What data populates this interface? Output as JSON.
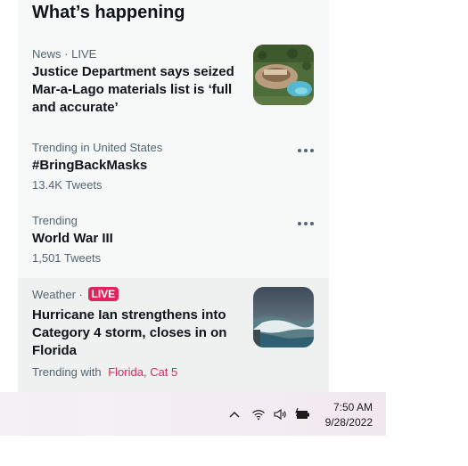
{
  "panel": {
    "title": "What’s happening"
  },
  "items": [
    {
      "category": "News",
      "separator": "·",
      "status": "LIVE",
      "headline_lines": [
        "Justice Department says seized",
        "Mar-a-Lago materials list is ‘full",
        "and accurate’"
      ],
      "thumbnail": "mar-a-lago-aerial-photo"
    },
    {
      "context": "Trending in United States",
      "topic": "#BringBackMasks",
      "count": "13.4K Tweets"
    },
    {
      "context": "Trending",
      "topic": "World War III",
      "count": "1,501 Tweets"
    },
    {
      "category": "Weather",
      "separator": "·",
      "live_badge": "LIVE",
      "headline_lines": [
        "Hurricane Ian strengthens into",
        "Category 4 storm, closes in on",
        "Florida"
      ],
      "trending_with_label": "Trending with",
      "trending_with_links": [
        "Florida",
        "Cat 5"
      ],
      "link_separator": ",",
      "thumbnail": "stormy-sea-photo"
    }
  ],
  "taskbar": {
    "time": "7:50 AM",
    "date": "9/28/2022",
    "icons": [
      "chevron-up-icon",
      "wifi-icon",
      "speaker-icon",
      "battery-charging-icon"
    ]
  },
  "colors": {
    "accent": "#e0245e",
    "muted": "#536471",
    "panel_bg": "#f7f9f9"
  }
}
